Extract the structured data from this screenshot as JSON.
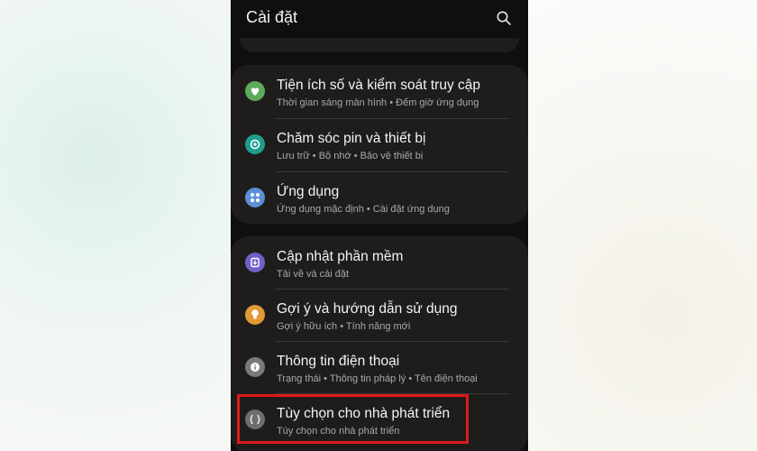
{
  "header": {
    "title": "Cài đặt",
    "search_icon": "search-icon"
  },
  "groups": [
    {
      "items": [
        {
          "title": "Tiện ích số và kiểm soát truy cập",
          "subtitle": "Thời gian sáng màn hình  •  Đếm giờ ứng dụng",
          "icon": "digital-wellbeing-icon",
          "icon_color": "#5dab5d"
        },
        {
          "title": "Chăm sóc pin và thiết bị",
          "subtitle": "Lưu trữ  •  Bộ nhớ  •  Bảo vệ thiết bị",
          "icon": "device-care-icon",
          "icon_color": "#1f9e8e"
        },
        {
          "title": "Ứng dụng",
          "subtitle": "Ứng dụng mặc định  •  Cài đặt ứng dụng",
          "icon": "apps-icon",
          "icon_color": "#5b8fd6"
        }
      ]
    },
    {
      "items": [
        {
          "title": "Cập nhật phần mềm",
          "subtitle": "Tải về và cài đặt",
          "icon": "software-update-icon",
          "icon_color": "#7160c8"
        },
        {
          "title": "Gợi ý và hướng dẫn sử dụng",
          "subtitle": "Gợi ý hữu ích  •  Tính năng mới",
          "icon": "tips-icon",
          "icon_color": "#e09a34"
        },
        {
          "title": "Thông tin điện thoại",
          "subtitle": "Trạng thái  •  Thông tin pháp lý  •  Tên điện thoại",
          "icon": "about-phone-icon",
          "icon_color": "#7a7a7a"
        },
        {
          "title": "Tùy chọn cho nhà phát triển",
          "subtitle": "Tùy chọn cho nhà phát triển",
          "icon": "developer-options-icon",
          "icon_color": "#6e6e6e"
        }
      ]
    }
  ],
  "highlight_color": "#e01919"
}
